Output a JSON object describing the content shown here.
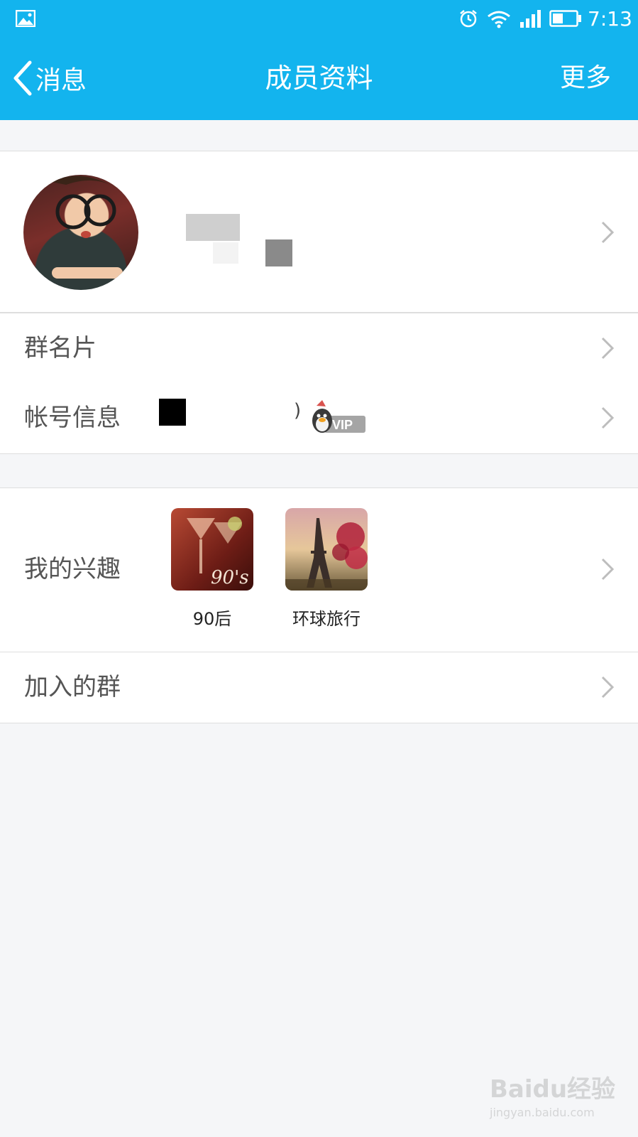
{
  "status_bar": {
    "time": "7:13",
    "icons": [
      "image-icon",
      "alarm-icon",
      "wifi-icon",
      "signal-icon",
      "battery-icon"
    ]
  },
  "nav": {
    "back_label": "消息",
    "title": "成员资料",
    "more_label": "更多"
  },
  "profile": {
    "avatar": "avatar"
  },
  "rows": {
    "group_card_label": "群名片",
    "account_info_label": "帐号信息",
    "account_paren": ")",
    "vip_badge": "VIP",
    "interests_label": "我的兴趣",
    "joined_groups_label": "加入的群"
  },
  "interests": [
    {
      "label": "90后",
      "image_text": "90's"
    },
    {
      "label": "环球旅行"
    }
  ],
  "watermark": {
    "brand": "Baidu经验",
    "url": "jingyan.baidu.com"
  },
  "colors": {
    "accent": "#13b4ee",
    "background": "#f5f6f8",
    "divider": "#dedede"
  }
}
